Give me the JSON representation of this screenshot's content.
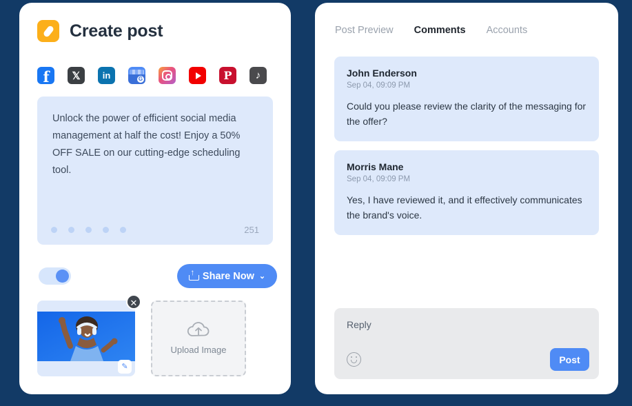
{
  "theme": {
    "background": "#123A66",
    "card_background": "#ffffff",
    "accent_blue": "#4F8BF5",
    "soft_blue": "#DEE9FB",
    "logo_orange": "#FCAF1A"
  },
  "left_panel": {
    "title": "Create post",
    "logo_icon": "pen-logo-icon",
    "networks": [
      {
        "name": "facebook",
        "label": "f"
      },
      {
        "name": "x-twitter",
        "label": "𝕏"
      },
      {
        "name": "linkedin",
        "label": "in"
      },
      {
        "name": "google-business",
        "label": "G"
      },
      {
        "name": "instagram",
        "label": ""
      },
      {
        "name": "youtube",
        "label": ""
      },
      {
        "name": "pinterest",
        "label": "P"
      },
      {
        "name": "tiktok",
        "label": "♪"
      }
    ],
    "compose": {
      "text": "Unlock the power of efficient social media management at half the cost!  Enjoy a 50% OFF SALE on our cutting-edge scheduling tool.",
      "char_count": "251",
      "dot_count": 5
    },
    "toggle": {
      "name": "publish-toggle",
      "state": "on"
    },
    "share_button": {
      "label": "Share Now",
      "upload_icon": "upload-icon",
      "chevron": "⌄"
    },
    "media": {
      "thumbnail_alt": "woman-with-headphones-dancing",
      "close_icon": "✕",
      "edit_icon": "✎",
      "upload_label": "Upload Image",
      "upload_icon": "cloud-upload-icon"
    }
  },
  "right_panel": {
    "tabs": [
      {
        "label": "Post Preview",
        "active": false
      },
      {
        "label": "Comments",
        "active": true
      },
      {
        "label": "Accounts",
        "active": false
      }
    ],
    "comments": [
      {
        "author": "John Enderson",
        "timestamp": "Sep 04, 09:09 PM",
        "body": "Could you please review the clarity of the messaging for the offer?"
      },
      {
        "author": "Morris Mane",
        "timestamp": "Sep 04, 09:09 PM",
        "body": "Yes, I have reviewed it, and it effectively communicates the brand's voice."
      }
    ],
    "reply": {
      "placeholder": "Reply",
      "value": "",
      "emoji_icon": "smiley-icon",
      "post_label": "Post"
    }
  }
}
